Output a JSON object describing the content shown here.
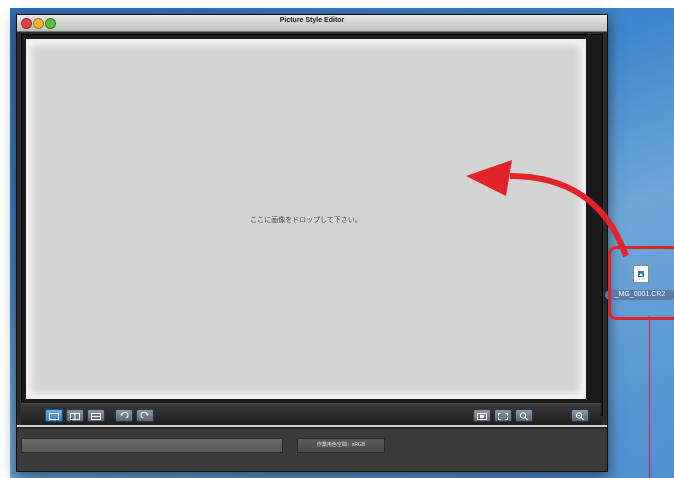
{
  "window": {
    "title": "Picture Style Editor"
  },
  "canvas": {
    "drop_message": "ここに画像をドロップして下さい。"
  },
  "toolbar": {
    "left_buttons": [
      "view-single-icon",
      "view-split-vertical-icon",
      "view-split-horizontal-icon",
      "rotate-left-icon",
      "rotate-right-icon"
    ],
    "right_buttons": [
      "fit-window-icon",
      "full-screen-icon",
      "zoom-icon",
      "zoom-out-icon"
    ]
  },
  "statusbar": {
    "color_space": "作業用色空間：sRGB"
  },
  "desktop_file": {
    "name": "_MG_0001.CR2"
  },
  "annotation": {
    "color": "#e2232a"
  }
}
